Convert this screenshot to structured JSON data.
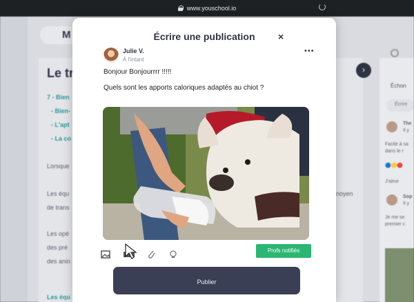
{
  "browser": {
    "url": "www.youschool.io"
  },
  "background": {
    "header_pill": "M",
    "page_title": "Le tr",
    "links": [
      "7 - Bien",
      "- Bien-",
      "- L'apt",
      "- La co"
    ],
    "paragraphs": [
      "Lorsque",
      "Les équ",
      "de trans",
      "Les opé",
      "des pré",
      "des anin"
    ],
    "link_bottom": "Les équ",
    "right_words": [
      "noyen"
    ],
    "right_panel": {
      "tab": "Échon",
      "write": "Écrire",
      "post1_name": "The",
      "post1_time": "Il y",
      "post1_text": [
        "Facile à sa",
        "dans le r"
      ],
      "likes": "J'aime",
      "post2_name": "Sop",
      "post2_time": "Il y",
      "post2_text": [
        "Je me se",
        "premier c"
      ]
    }
  },
  "modal": {
    "title": "Écrire une publication",
    "author": "Julie V.",
    "time": "À l'intant",
    "line1": "Bonjour Bonjourrrr !!!!!",
    "line2": "Quels sont les apports caloriques adaptés au chiot ?",
    "toolbar_icons": [
      "image-icon",
      "video-icon",
      "attachment-icon",
      "lightbulb-icon"
    ],
    "profs_button": "Profs notifiés",
    "publish_button": "Publier"
  },
  "colors": {
    "accent": "#2bb673",
    "primary": "#3a3f55",
    "link": "#2a9a9a"
  }
}
